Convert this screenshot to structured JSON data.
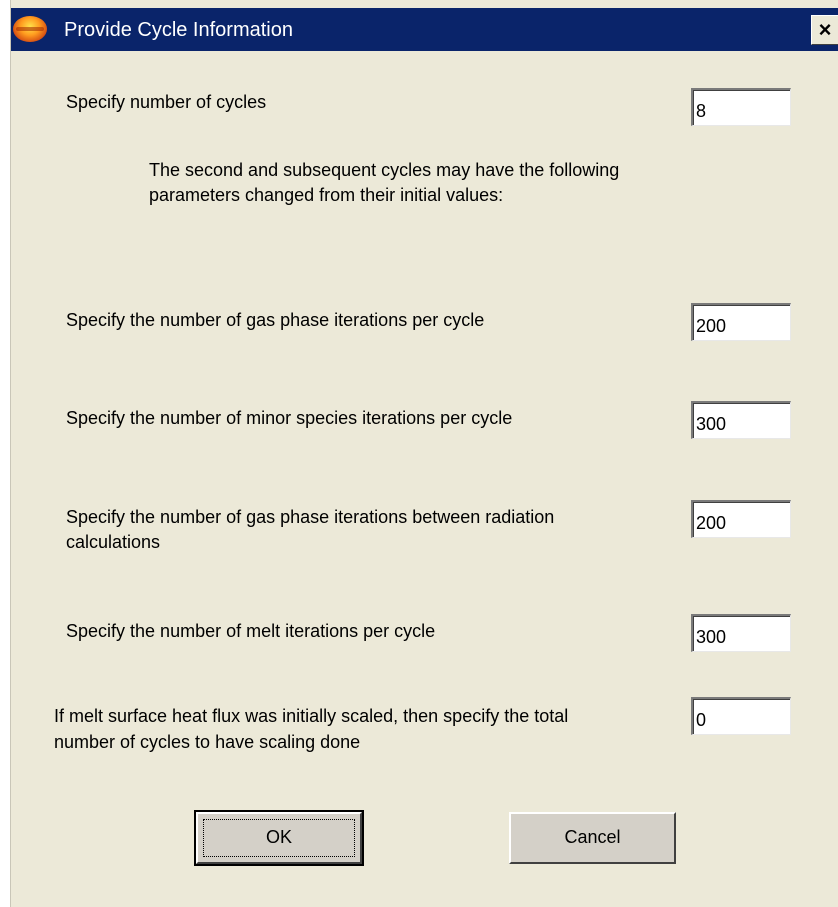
{
  "window": {
    "title": "Provide Cycle Information",
    "close_label": "×"
  },
  "intro": {
    "cycles_label": "Specify number of cycles",
    "note": "The second and subsequent cycles may have the following parameters changed from their initial values:"
  },
  "fields": {
    "num_cycles": "8",
    "gas_phase_iterations": "200",
    "minor_species_iterations": "300",
    "radiation_interval": "200",
    "melt_iterations": "300",
    "scaling_cycles": "0"
  },
  "labels": {
    "gas_phase_iterations": "Specify the number of gas phase iterations per cycle",
    "minor_species_iterations": "Specify the number of minor species iterations per cycle",
    "radiation_interval": "Specify the number of gas phase iterations between radiation calculations",
    "melt_iterations": "Specify the number of melt iterations per cycle",
    "scaling_cycles": "If melt surface heat flux was initially scaled, then specify the total number of cycles to have scaling done"
  },
  "buttons": {
    "ok": "OK",
    "cancel": "Cancel"
  },
  "colors": {
    "titlebar": "#0a246a",
    "dialog_bg": "#ece9d8",
    "button_face": "#d4d0c8"
  }
}
